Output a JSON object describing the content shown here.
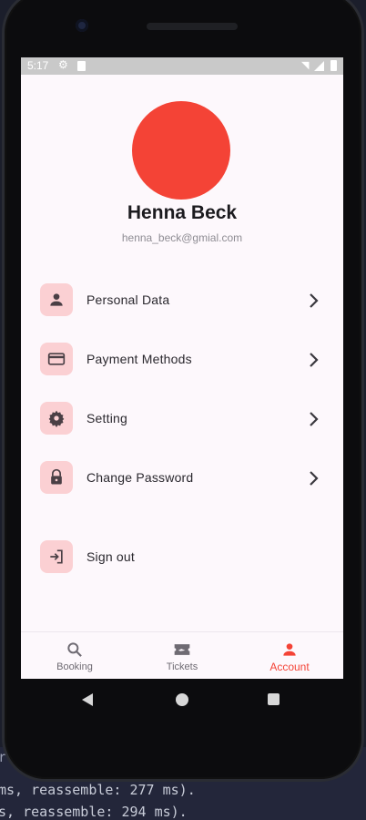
{
  "terminal": {
    "lines": [
      "r",
      "ms, reassemble: 277 ms).",
      "s, reassemble: 294 ms)."
    ]
  },
  "status_bar": {
    "time": "5:17",
    "icons": [
      "gear-icon",
      "sd-card-icon",
      "wifi-icon",
      "signal-icon",
      "battery-icon"
    ]
  },
  "profile": {
    "name": "Henna Beck",
    "email": "henna_beck@gmial.com",
    "avatar_color": "#f44336"
  },
  "menu": {
    "items": [
      {
        "label": "Personal Data",
        "icon": "person-icon"
      },
      {
        "label": "Payment Methods",
        "icon": "credit-card-icon"
      },
      {
        "label": "Setting",
        "icon": "gear-icon"
      },
      {
        "label": "Change Password",
        "icon": "lock-icon"
      }
    ],
    "sign_out": {
      "label": "Sign out",
      "icon": "logout-icon"
    }
  },
  "bottom_nav": {
    "items": [
      {
        "label": "Booking",
        "icon": "search-icon",
        "active": false
      },
      {
        "label": "Tickets",
        "icon": "ticket-icon",
        "active": false
      },
      {
        "label": "Account",
        "icon": "person-icon",
        "active": true
      }
    ]
  },
  "colors": {
    "accent": "#f44336",
    "icon_tile": "#fbd0d3",
    "screen_bg": "#fdf8fc"
  }
}
